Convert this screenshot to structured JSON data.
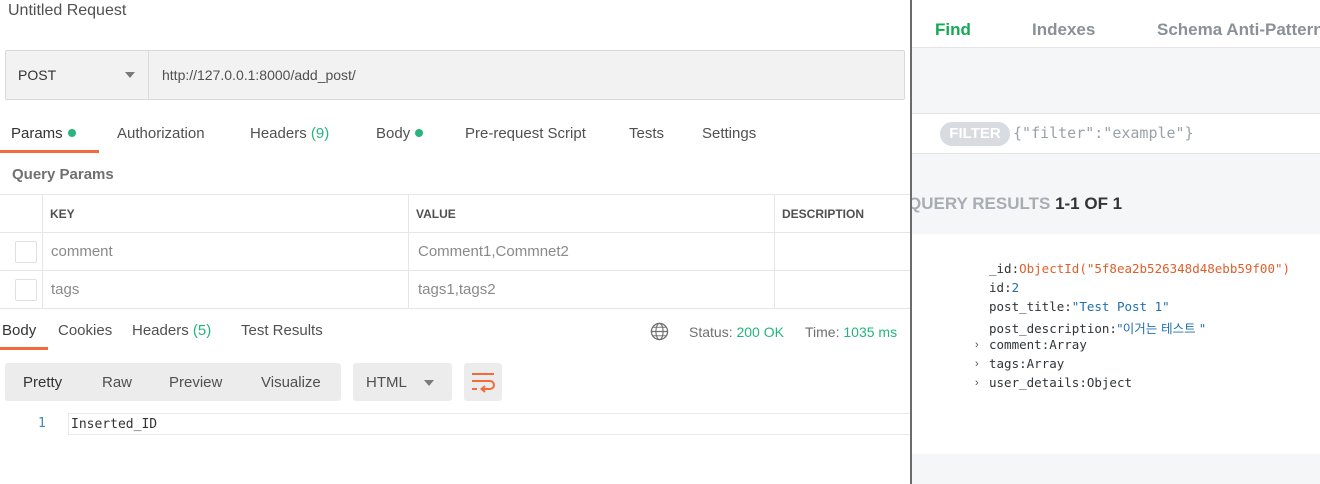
{
  "postman": {
    "request_title": "Untitled Request",
    "method": "POST",
    "url": "http://127.0.0.1:8000/add_post/",
    "tabs": [
      {
        "label": "Params",
        "dot": true
      },
      {
        "label": "Authorization"
      },
      {
        "label": "Headers",
        "count": "(9)"
      },
      {
        "label": "Body",
        "dot": true
      },
      {
        "label": "Pre-request Script"
      },
      {
        "label": "Tests"
      },
      {
        "label": "Settings"
      }
    ],
    "query_params_title": "Query Params",
    "table": {
      "headers": [
        "KEY",
        "VALUE",
        "DESCRIPTION"
      ],
      "rows": [
        {
          "key": "comment",
          "value": "Comment1,Commnet2",
          "description": ""
        },
        {
          "key": "tags",
          "value": "tags1,tags2",
          "description": ""
        }
      ]
    },
    "response_tabs": [
      {
        "label": "Body"
      },
      {
        "label": "Cookies"
      },
      {
        "label": "Headers",
        "count": "(5)"
      },
      {
        "label": "Test Results"
      }
    ],
    "status_label": "Status:",
    "status_value": "200 OK",
    "time_label": "Time:",
    "time_value": "1035 ms",
    "view_modes": [
      "Pretty",
      "Raw",
      "Preview",
      "Visualize"
    ],
    "format": "HTML",
    "editor": {
      "line_number": "1",
      "content": "Inserted_ID"
    },
    "accent_color": "#f26b3a",
    "green_color": "#26b47f"
  },
  "compass": {
    "tabs": [
      "Find",
      "Indexes",
      "Schema Anti-Patterns"
    ],
    "filter_label": "FILTER",
    "filter_placeholder": "{\"filter\":\"example\"}",
    "results_label": "QUERY RESULTS",
    "results_range": "1-1 OF 1",
    "document": [
      {
        "key": "_id",
        "value": "ObjectId(\"5f8ea2b526348d48ebb59f00\")",
        "kind": "oid"
      },
      {
        "key": "id",
        "value": "2",
        "kind": "num"
      },
      {
        "key": "post_title",
        "value": "\"Test Post 1\"",
        "kind": "str"
      },
      {
        "key": "post_description",
        "value": "\"이거는 테스트 \"",
        "kind": "str"
      },
      {
        "key": "comment",
        "value": "Array",
        "kind": "type",
        "expandable": true
      },
      {
        "key": "tags",
        "value": "Array",
        "kind": "type",
        "expandable": true
      },
      {
        "key": "user_details",
        "value": "Object",
        "kind": "type",
        "expandable": true
      }
    ],
    "accent_color": "#13aa52"
  }
}
